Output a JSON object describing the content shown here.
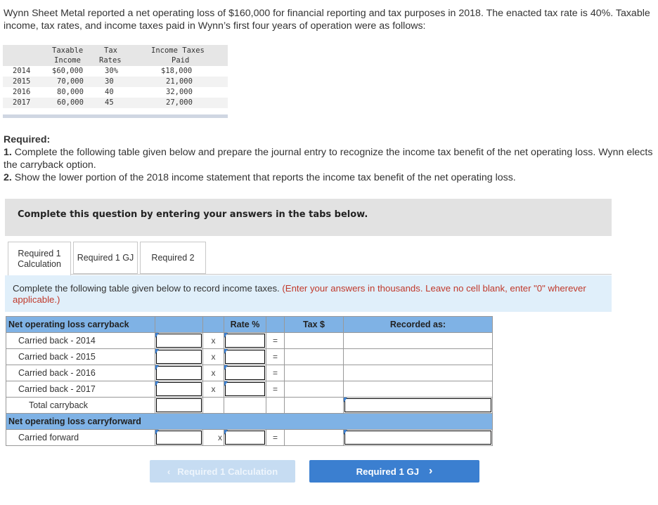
{
  "intro": "Wynn Sheet Metal reported a net operating loss of $160,000 for financial reporting and tax purposes in 2018. The enacted tax rate is 40%. Taxable income, tax rates, and income taxes paid in Wynn’s first four years of operation were as follows:",
  "history_table": {
    "headers": {
      "income_1": "Taxable",
      "income_2": "Income",
      "rate_1": "Tax",
      "rate_2": "Rates",
      "taxes_1": "Income Taxes",
      "taxes_2": "Paid"
    },
    "rows": [
      {
        "year": "2014",
        "income": "$60,000",
        "rate": "30%",
        "taxes": "$18,000"
      },
      {
        "year": "2015",
        "income": "70,000",
        "rate": "30",
        "taxes": "21,000"
      },
      {
        "year": "2016",
        "income": "80,000",
        "rate": "40",
        "taxes": "32,000"
      },
      {
        "year": "2017",
        "income": "60,000",
        "rate": "45",
        "taxes": "27,000"
      }
    ]
  },
  "required": {
    "heading": "Required:",
    "item1_num": "1.",
    "item1_text": " Complete the following table given below and prepare the journal entry to recognize the income tax benefit of the net operating loss. Wynn elects the carryback option.",
    "item2_num": "2.",
    "item2_text": " Show the lower portion of the 2018 income statement that reports the income tax benefit of the net operating loss."
  },
  "banner": "Complete this question by entering your answers in the tabs below.",
  "tabs": {
    "tab1_line1": "Required 1",
    "tab1_line2": "Calculation",
    "tab2": "Required 1 GJ",
    "tab3": "Required 2"
  },
  "instructions": {
    "main": "Complete the following table given below to record income taxes. ",
    "note": "(Enter your answers in thousands. Leave no cell blank, enter \"0\" wherever applicable.)"
  },
  "grid": {
    "header_label": "Net operating loss carryback",
    "col_rate": "Rate %",
    "col_tax": "Tax $",
    "col_recorded": "Recorded as:",
    "rows": [
      "Carried back - 2014",
      "Carried back - 2015",
      "Carried back - 2016",
      "Carried back - 2017"
    ],
    "total_label": "Total carryback",
    "forward_header": "Net operating loss carryforward",
    "forward_label": "Carried forward",
    "times": "x",
    "equals": "="
  },
  "nav": {
    "prev_label": "Required 1 Calculation",
    "next_label": "Required 1 GJ"
  },
  "colors": {
    "header_blue": "#7fb2e5",
    "next_button": "#3b7fd0",
    "prev_button_disabled": "#c6dcf2",
    "instruction_note_red": "#c0392b"
  }
}
